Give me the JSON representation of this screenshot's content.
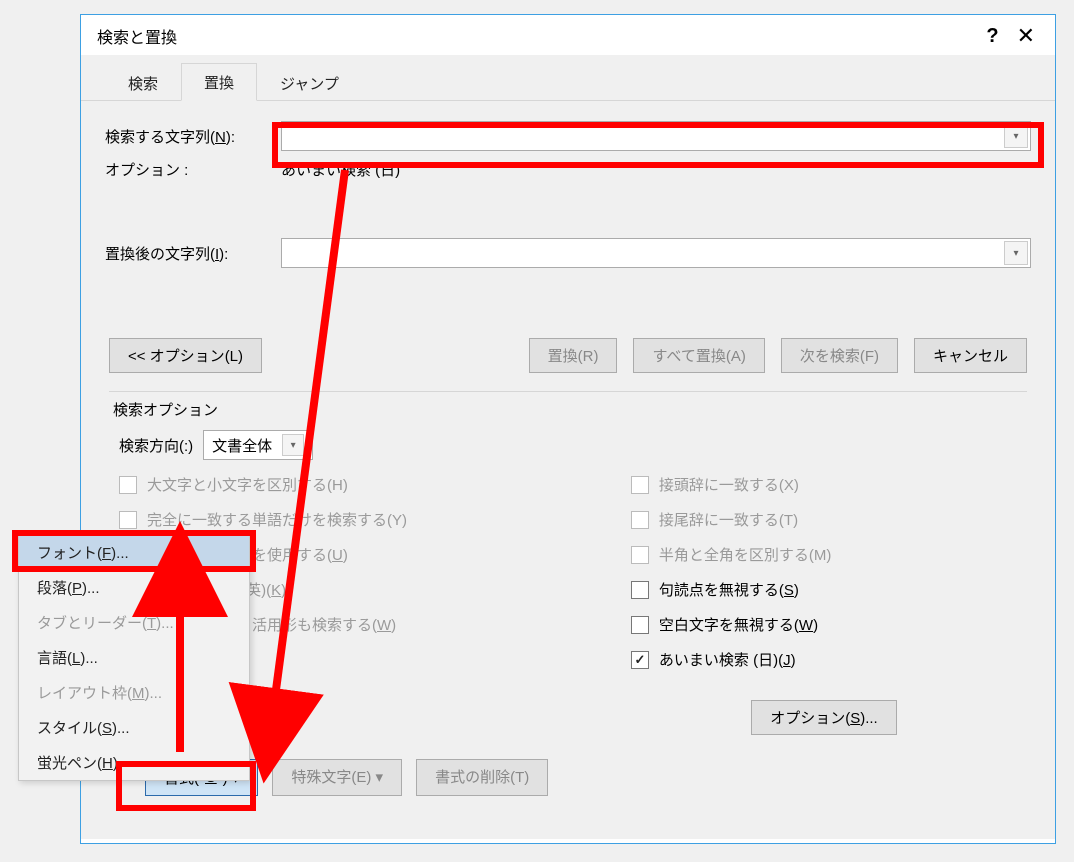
{
  "titlebar": {
    "title": "検索と置換"
  },
  "tabs": {
    "find": "検索",
    "replace": "置換",
    "jump": "ジャンプ"
  },
  "labels": {
    "find_what_pre": "検索する文字列(",
    "find_what_key": "N",
    "find_what_post": "):",
    "option": "オプション :",
    "option_value": "あいまい検索 (日)",
    "replace_with_pre": "置換後の文字列(",
    "replace_with_key": "I",
    "replace_with_post": "):"
  },
  "buttons": {
    "less": "<< オプション(L)",
    "replace": "置換(R)",
    "replace_all": "すべて置換(A)",
    "find_next": "次を検索(F)",
    "cancel": "キャンセル",
    "format_pre": "書式(",
    "format_key": "O",
    "format_post": ") ▾",
    "special": "特殊文字(E) ▾",
    "noformat": "書式の削除(T)",
    "options_dlg_pre": "オプション(",
    "options_dlg_key": "S",
    "options_dlg_post": "..."
  },
  "fieldset": {
    "title": "検索オプション",
    "direction_label": "検索方向(:)",
    "direction_value": "文書全体"
  },
  "checks_left": [
    {
      "label": "大文字と小文字を区別する(H)",
      "disabled": true
    },
    {
      "label": "完全に一致する単語だけを検索する(Y)",
      "disabled": true
    },
    {
      "label_pre": "ワイルドカードを使用する(",
      "key": "U",
      "label_post": ")",
      "disabled": true
    },
    {
      "label_pre": "あいまい検索 (英)(",
      "key": "K",
      "label_post": ")",
      "disabled": true
    },
    {
      "label_pre": "英単語の異なる活用形も検索する(",
      "key": "W",
      "label_post": ")",
      "disabled": true
    }
  ],
  "checks_right": [
    {
      "label": "接頭辞に一致する(X)",
      "disabled": true
    },
    {
      "label": "接尾辞に一致する(T)",
      "disabled": true
    },
    {
      "label": "半角と全角を区別する(M)",
      "disabled": true
    },
    {
      "label_pre": "句読点を無視する(",
      "key": "S",
      "label_post": ")",
      "disabled": false
    },
    {
      "label_pre": "空白文字を無視する(",
      "key": "W",
      "label_post": ")",
      "disabled": false
    },
    {
      "label_pre": "あいまい検索 (日)(",
      "key": "J",
      "label_post": ")",
      "disabled": false,
      "checked": true
    }
  ],
  "menu": {
    "font_pre": "フォント(",
    "font_key": "F",
    "font_post": ")...",
    "para_pre": "段落(",
    "para_key": "P",
    "para_post": ")...",
    "tab_pre": "タブとリーダー(",
    "tab_key": "T",
    "tab_post": ")...",
    "lang_pre": "言語(",
    "lang_key": "L",
    "lang_post": ")...",
    "frame_pre": "レイアウト枠(",
    "frame_key": "M",
    "frame_post": ")...",
    "style_pre": "スタイル(",
    "style_key": "S",
    "style_post": ")...",
    "hl_pre": "蛍光ペン(",
    "hl_key": "H",
    "hl_post": ")"
  }
}
